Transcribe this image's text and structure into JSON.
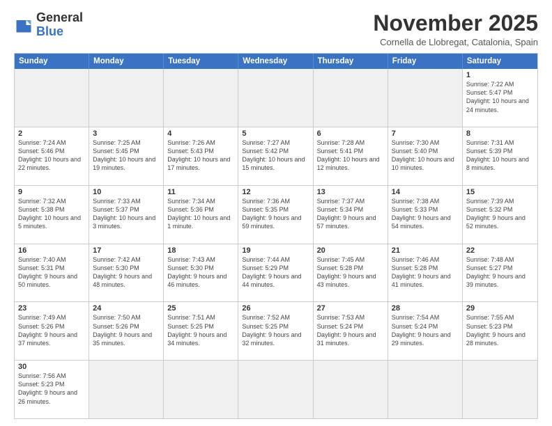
{
  "header": {
    "logo_general": "General",
    "logo_blue": "Blue",
    "month_title": "November 2025",
    "location": "Cornella de Llobregat, Catalonia, Spain"
  },
  "days_of_week": [
    "Sunday",
    "Monday",
    "Tuesday",
    "Wednesday",
    "Thursday",
    "Friday",
    "Saturday"
  ],
  "weeks": [
    [
      {
        "day": "",
        "empty": true
      },
      {
        "day": "",
        "empty": true
      },
      {
        "day": "",
        "empty": true
      },
      {
        "day": "",
        "empty": true
      },
      {
        "day": "",
        "empty": true
      },
      {
        "day": "",
        "empty": true
      },
      {
        "day": "1",
        "sunrise": "7:22 AM",
        "sunset": "5:47 PM",
        "daylight": "10 hours and 24 minutes."
      }
    ],
    [
      {
        "day": "2",
        "sunrise": "7:24 AM",
        "sunset": "5:46 PM",
        "daylight": "10 hours and 22 minutes."
      },
      {
        "day": "3",
        "sunrise": "7:25 AM",
        "sunset": "5:45 PM",
        "daylight": "10 hours and 19 minutes."
      },
      {
        "day": "4",
        "sunrise": "7:26 AM",
        "sunset": "5:43 PM",
        "daylight": "10 hours and 17 minutes."
      },
      {
        "day": "5",
        "sunrise": "7:27 AM",
        "sunset": "5:42 PM",
        "daylight": "10 hours and 15 minutes."
      },
      {
        "day": "6",
        "sunrise": "7:28 AM",
        "sunset": "5:41 PM",
        "daylight": "10 hours and 12 minutes."
      },
      {
        "day": "7",
        "sunrise": "7:30 AM",
        "sunset": "5:40 PM",
        "daylight": "10 hours and 10 minutes."
      },
      {
        "day": "8",
        "sunrise": "7:31 AM",
        "sunset": "5:39 PM",
        "daylight": "10 hours and 8 minutes."
      }
    ],
    [
      {
        "day": "9",
        "sunrise": "7:32 AM",
        "sunset": "5:38 PM",
        "daylight": "10 hours and 5 minutes."
      },
      {
        "day": "10",
        "sunrise": "7:33 AM",
        "sunset": "5:37 PM",
        "daylight": "10 hours and 3 minutes."
      },
      {
        "day": "11",
        "sunrise": "7:34 AM",
        "sunset": "5:36 PM",
        "daylight": "10 hours and 1 minute."
      },
      {
        "day": "12",
        "sunrise": "7:36 AM",
        "sunset": "5:35 PM",
        "daylight": "9 hours and 59 minutes."
      },
      {
        "day": "13",
        "sunrise": "7:37 AM",
        "sunset": "5:34 PM",
        "daylight": "9 hours and 57 minutes."
      },
      {
        "day": "14",
        "sunrise": "7:38 AM",
        "sunset": "5:33 PM",
        "daylight": "9 hours and 54 minutes."
      },
      {
        "day": "15",
        "sunrise": "7:39 AM",
        "sunset": "5:32 PM",
        "daylight": "9 hours and 52 minutes."
      }
    ],
    [
      {
        "day": "16",
        "sunrise": "7:40 AM",
        "sunset": "5:31 PM",
        "daylight": "9 hours and 50 minutes."
      },
      {
        "day": "17",
        "sunrise": "7:42 AM",
        "sunset": "5:30 PM",
        "daylight": "9 hours and 48 minutes."
      },
      {
        "day": "18",
        "sunrise": "7:43 AM",
        "sunset": "5:30 PM",
        "daylight": "9 hours and 46 minutes."
      },
      {
        "day": "19",
        "sunrise": "7:44 AM",
        "sunset": "5:29 PM",
        "daylight": "9 hours and 44 minutes."
      },
      {
        "day": "20",
        "sunrise": "7:45 AM",
        "sunset": "5:28 PM",
        "daylight": "9 hours and 43 minutes."
      },
      {
        "day": "21",
        "sunrise": "7:46 AM",
        "sunset": "5:28 PM",
        "daylight": "9 hours and 41 minutes."
      },
      {
        "day": "22",
        "sunrise": "7:48 AM",
        "sunset": "5:27 PM",
        "daylight": "9 hours and 39 minutes."
      }
    ],
    [
      {
        "day": "23",
        "sunrise": "7:49 AM",
        "sunset": "5:26 PM",
        "daylight": "9 hours and 37 minutes."
      },
      {
        "day": "24",
        "sunrise": "7:50 AM",
        "sunset": "5:26 PM",
        "daylight": "9 hours and 35 minutes."
      },
      {
        "day": "25",
        "sunrise": "7:51 AM",
        "sunset": "5:25 PM",
        "daylight": "9 hours and 34 minutes."
      },
      {
        "day": "26",
        "sunrise": "7:52 AM",
        "sunset": "5:25 PM",
        "daylight": "9 hours and 32 minutes."
      },
      {
        "day": "27",
        "sunrise": "7:53 AM",
        "sunset": "5:24 PM",
        "daylight": "9 hours and 31 minutes."
      },
      {
        "day": "28",
        "sunrise": "7:54 AM",
        "sunset": "5:24 PM",
        "daylight": "9 hours and 29 minutes."
      },
      {
        "day": "29",
        "sunrise": "7:55 AM",
        "sunset": "5:23 PM",
        "daylight": "9 hours and 28 minutes."
      }
    ],
    [
      {
        "day": "30",
        "sunrise": "7:56 AM",
        "sunset": "5:23 PM",
        "daylight": "9 hours and 26 minutes."
      },
      {
        "day": "",
        "empty": true
      },
      {
        "day": "",
        "empty": true
      },
      {
        "day": "",
        "empty": true
      },
      {
        "day": "",
        "empty": true
      },
      {
        "day": "",
        "empty": true
      },
      {
        "day": "",
        "empty": true
      }
    ]
  ]
}
